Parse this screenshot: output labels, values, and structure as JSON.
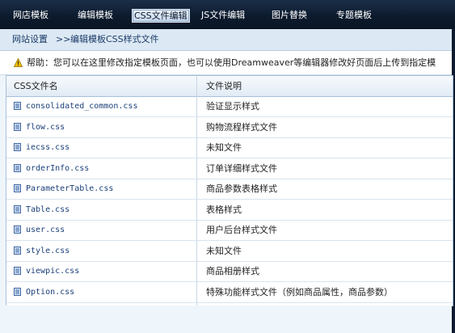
{
  "nav": {
    "items": [
      {
        "label": "网店模板"
      },
      {
        "label": "编辑模板"
      },
      {
        "label": "CSS文件编辑",
        "active": true
      },
      {
        "label": "JS文件编辑"
      },
      {
        "label": "图片替换"
      },
      {
        "label": "专题模板"
      }
    ]
  },
  "breadcrumb": {
    "root": "网站设置",
    "separator": ">>",
    "current": "编辑模板CSS样式文件"
  },
  "help": {
    "icon": "warning-icon",
    "text": "帮助：您可以在这里修改指定模板页面，也可以使用Dreamweaver等编辑器修改好页面后上传到指定模"
  },
  "table": {
    "headers": {
      "name": "CSS文件名",
      "desc": "文件说明"
    },
    "rows": [
      {
        "file": "consolidated_common.css",
        "desc": "验证显示样式"
      },
      {
        "file": "flow.css",
        "desc": "购物流程样式文件"
      },
      {
        "file": "iecss.css",
        "desc": "未知文件"
      },
      {
        "file": "orderInfo.css",
        "desc": "订单详细样式文件"
      },
      {
        "file": "ParameterTable.css",
        "desc": "商品参数表格样式"
      },
      {
        "file": "Table.css",
        "desc": "表格样式"
      },
      {
        "file": "user.css",
        "desc": "用户后台样式文件"
      },
      {
        "file": "style.css",
        "desc": "未知文件"
      },
      {
        "file": "viewpic.css",
        "desc": "商品相册样式"
      },
      {
        "file": "Option.css",
        "desc": "特殊功能样式文件（例如商品属性，商品参数）"
      }
    ]
  },
  "colors": {
    "topbar": "#0c1a2c",
    "link": "#1a3f7a",
    "warning": "#f2c200"
  }
}
